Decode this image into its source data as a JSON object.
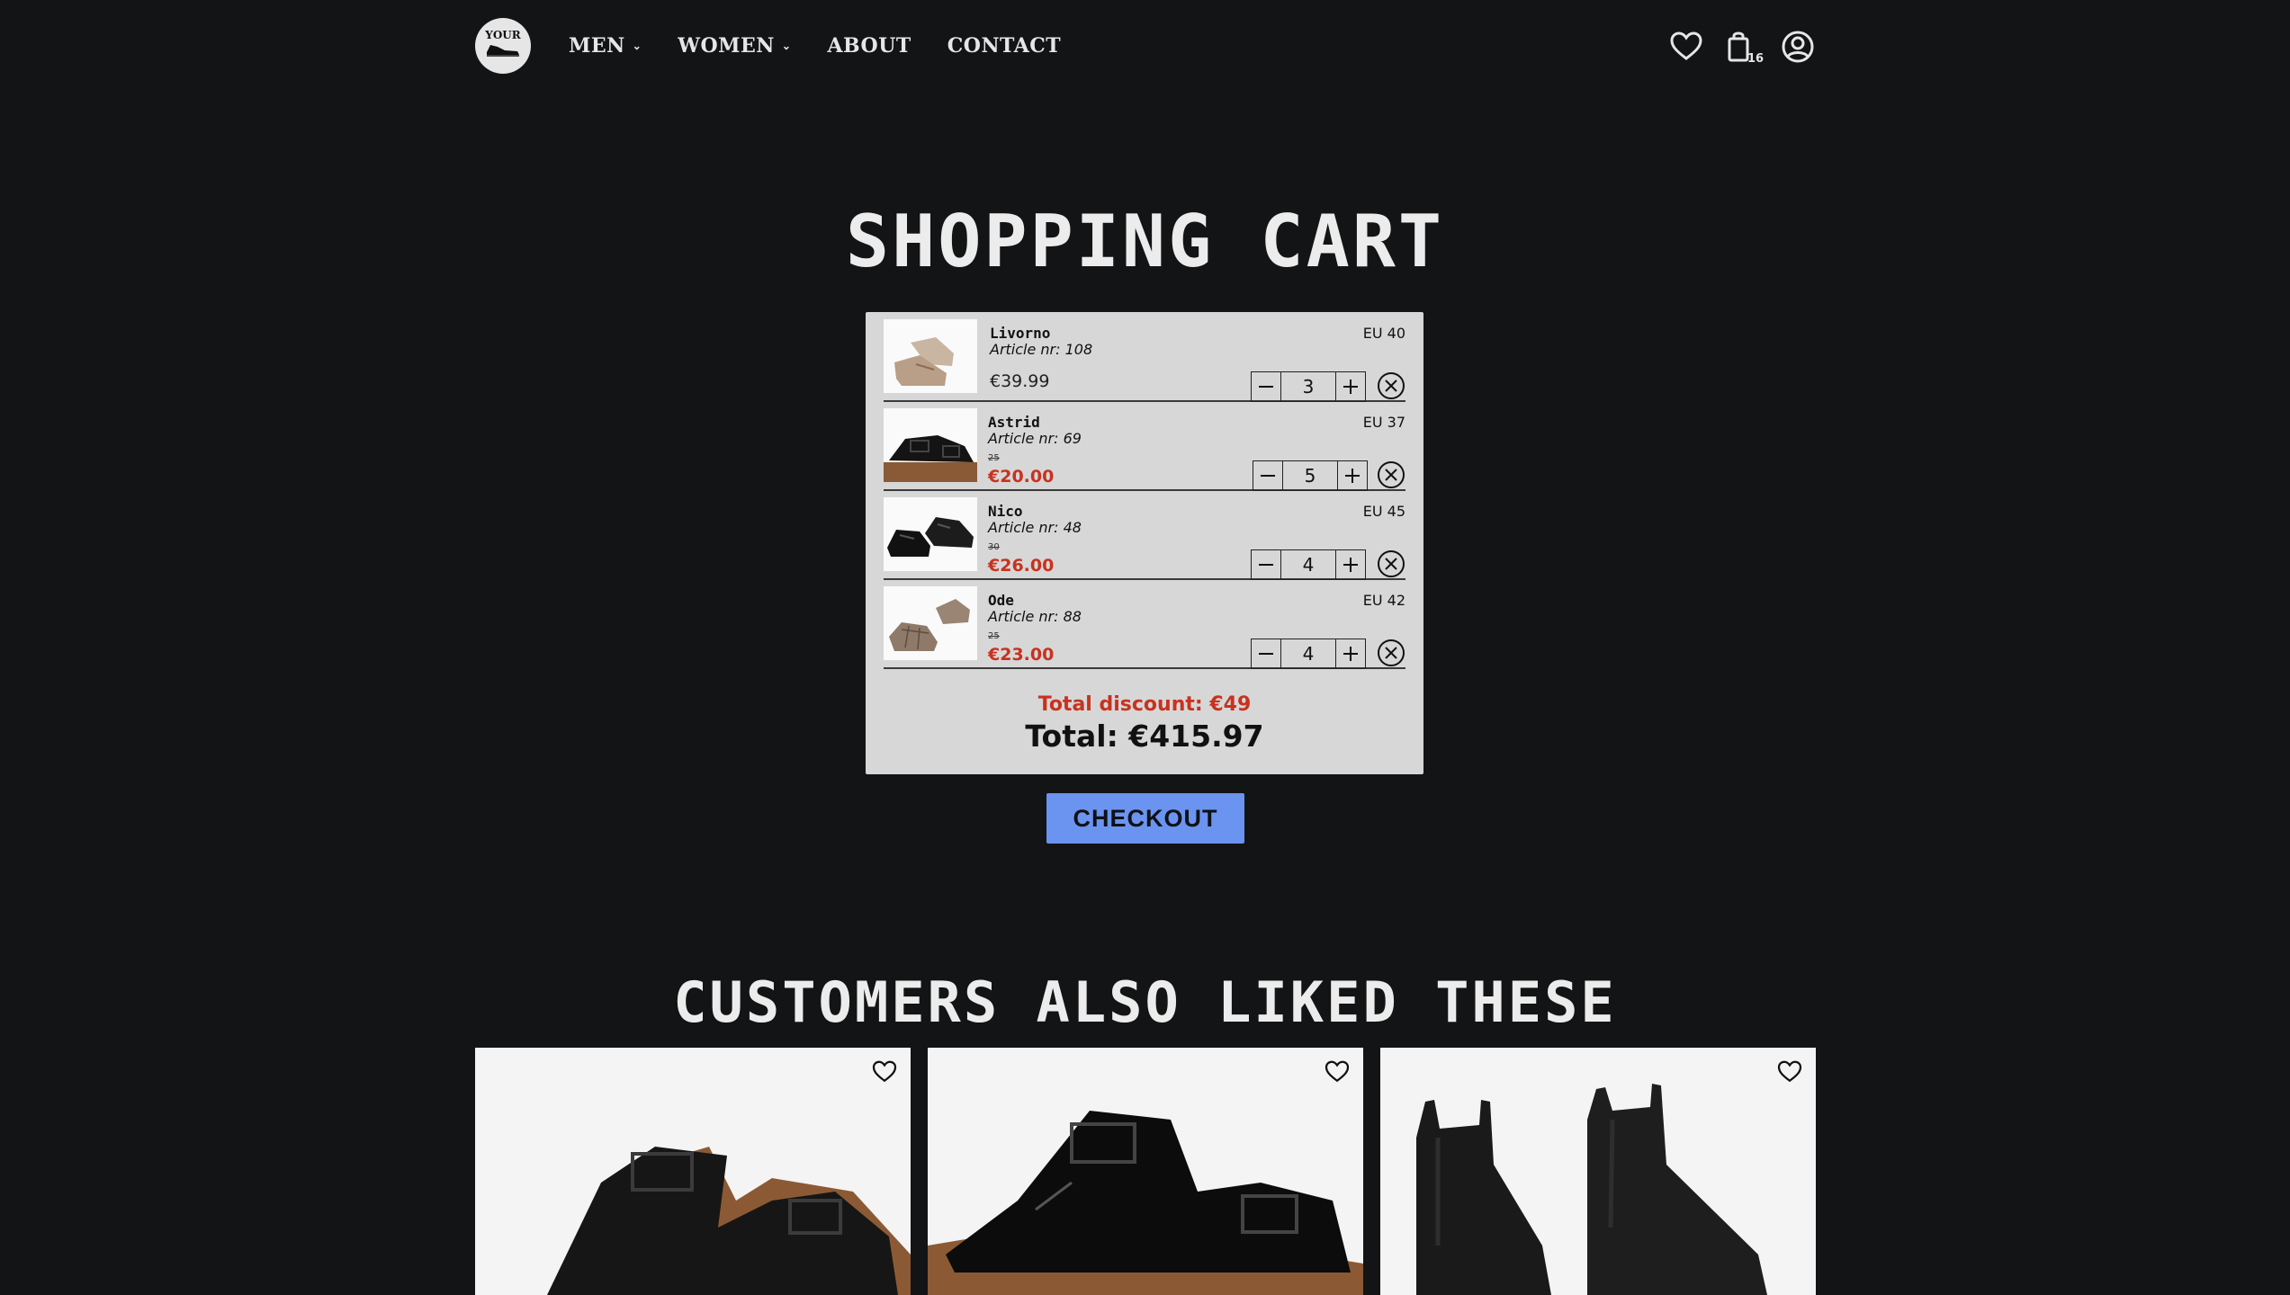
{
  "nav": {
    "logo_text": "YOUR",
    "links": [
      {
        "label": "MEN",
        "has_dropdown": true
      },
      {
        "label": "WOMEN",
        "has_dropdown": true
      },
      {
        "label": "ABOUT",
        "has_dropdown": false
      },
      {
        "label": "CONTACT",
        "has_dropdown": false
      }
    ],
    "dropdown_glyph": "⌄",
    "cart_count": "16",
    "icons": [
      "heart-icon",
      "shopping-bag-icon",
      "user-icon"
    ]
  },
  "page_title": "SHOPPING CART",
  "cart": {
    "items": [
      {
        "name": "Livorno",
        "article": "Article nr: 108",
        "size": "EU 40",
        "price": "€39.99",
        "old_price": "",
        "on_sale": false,
        "quantity": "3"
      },
      {
        "name": "Astrid",
        "article": "Article nr: 69",
        "size": "EU 37",
        "price": "€20.00",
        "old_price": "25",
        "on_sale": true,
        "quantity": "5"
      },
      {
        "name": "Nico",
        "article": "Article nr: 48",
        "size": "EU 45",
        "price": "€26.00",
        "old_price": "30",
        "on_sale": true,
        "quantity": "4"
      },
      {
        "name": "Ode",
        "article": "Article nr: 88",
        "size": "EU 42",
        "price": "€23.00",
        "old_price": "25",
        "on_sale": true,
        "quantity": "4"
      }
    ],
    "total_discount": "Total discount: €49",
    "total": "Total: €415.97"
  },
  "checkout_label": "CHECKOUT",
  "also_liked_title": "CUSTOMERS ALSO LIKED THESE",
  "colors": {
    "background": "#131415",
    "panel": "#d7d7d7",
    "sale_red": "#c8321f",
    "checkout_blue": "#6b94f0"
  }
}
